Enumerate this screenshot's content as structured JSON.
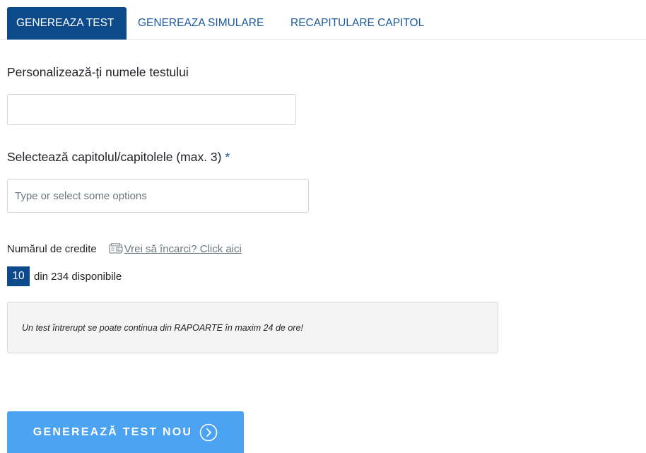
{
  "tabs": [
    {
      "label": "GENEREAZA TEST",
      "active": true
    },
    {
      "label": "GENEREAZA SIMULARE",
      "active": false
    },
    {
      "label": "RECAPITULARE CAPITOL",
      "active": false
    }
  ],
  "form": {
    "test_name_label": "Personalizează-ți numele testului",
    "test_name_value": "",
    "chapters_label": "Selectează capitolul/capitolele (max. 3)",
    "chapters_required_mark": "*",
    "chapters_placeholder": "Type or select some options"
  },
  "credits": {
    "label": "Numărul de credite",
    "topup_icon": "wallet-icon",
    "topup_link": "Vrei să încarci? Click aici",
    "count": "10",
    "available_text": "din 234 disponibile"
  },
  "notice": {
    "text": "Un test întrerupt se poate continua din RAPOARTE în maxim 24 de ore!"
  },
  "cta": {
    "label": "GENEREAZĂ TEST NOU",
    "icon": "chevron-right-circle-icon"
  },
  "colors": {
    "primary_dark": "#0d4a8c",
    "link_blue": "#1c5a9c",
    "cta_blue": "#4ba3f2",
    "notice_bg": "#f4f4f4"
  }
}
